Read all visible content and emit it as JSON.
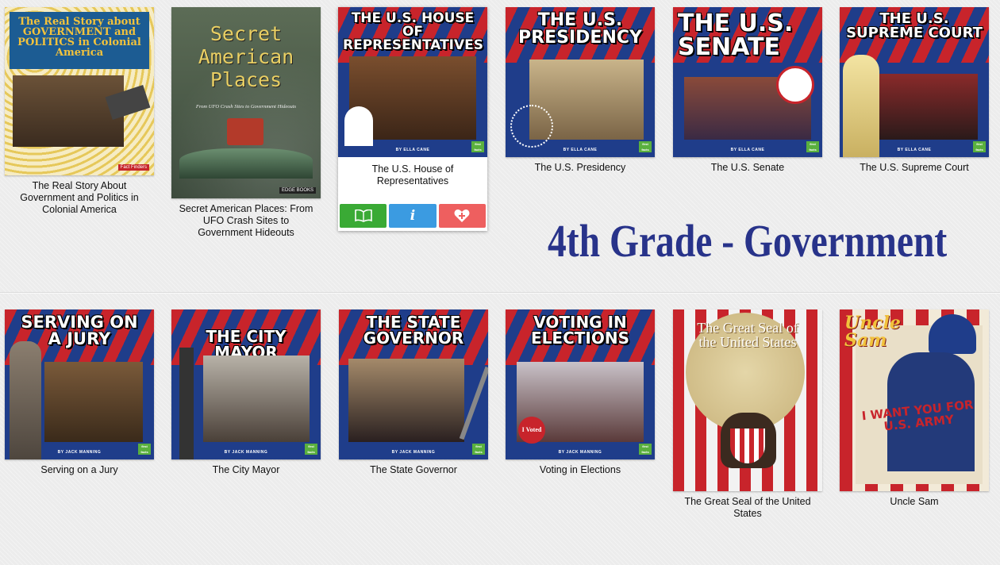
{
  "heading": "4th Grade - Government",
  "colors": {
    "heading": "#28338a",
    "read_button": "#3aaa35",
    "info_button": "#3b9be1",
    "favorite_button": "#ee5f5f"
  },
  "icons": {
    "read": "open-book-icon",
    "info": "info-icon",
    "favorite": "heart-plus-icon"
  },
  "books": [
    {
      "caption": "The Real Story About Government and Politics in Colonial America",
      "cover_title": "The Real Story about GOVERNMENT and POLITICS in Colonial America",
      "publisher": "Fact Finders"
    },
    {
      "caption": "Secret American Places: From UFO Crash Sites to Government Hideouts",
      "cover_title": "Secret American Places",
      "cover_subtitle": "From UFO Crash Sites to Government Hideouts",
      "publisher": "EDGE BOOKS"
    },
    {
      "caption": "The U.S. House of Representatives",
      "cover_title": "THE U.S. HOUSE OF REPRESENTATIVES",
      "author": "BY ELLA CANE"
    },
    {
      "caption": "The U.S. Presidency",
      "cover_title": "THE U.S. PRESIDENCY",
      "author": "BY ELLA CANE"
    },
    {
      "caption": "The U.S. Senate",
      "cover_title": "THE U.S. SENATE",
      "author": "BY ELLA CANE"
    },
    {
      "caption": "The U.S. Supreme Court",
      "cover_title": "THE U.S. SUPREME COURT",
      "author": "BY ELLA CANE"
    },
    {
      "caption": "Serving on a Jury",
      "cover_title": "SERVING ON A JURY",
      "author": "BY JACK MANNING"
    },
    {
      "caption": "The City Mayor",
      "cover_title": "THE CITY MAYOR",
      "author": "BY JACK MANNING"
    },
    {
      "caption": "The State Governor",
      "cover_title": "THE STATE GOVERNOR",
      "author": "BY JACK MANNING"
    },
    {
      "caption": "Voting in Elections",
      "cover_title": "VOTING IN ELECTIONS",
      "author": "BY JACK MANNING",
      "badge": "I Voted"
    },
    {
      "caption": "The Great Seal of the United States",
      "cover_title": "The Great Seal of the United States"
    },
    {
      "caption": "Uncle Sam",
      "cover_title": "Uncle Sam",
      "poster_text": "I WANT YOU FOR U.S. ARMY"
    }
  ]
}
